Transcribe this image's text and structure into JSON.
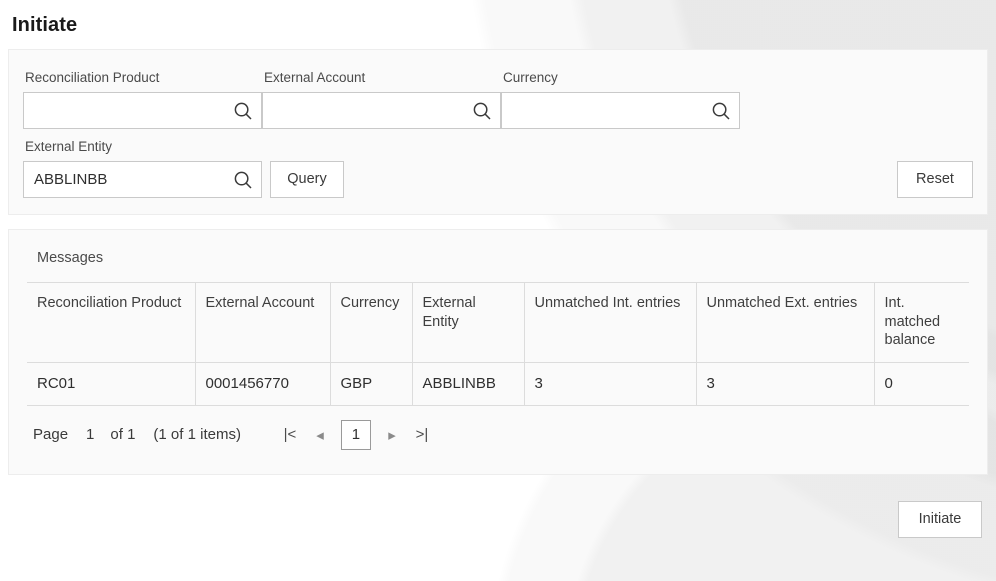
{
  "page": {
    "title": "Initiate"
  },
  "filters": {
    "fields": [
      {
        "label": "Reconciliation Product",
        "value": "",
        "placeholder": "",
        "icon": "search-icon"
      },
      {
        "label": "External Account",
        "value": "",
        "placeholder": "",
        "icon": "search-icon"
      },
      {
        "label": "Currency",
        "value": "",
        "placeholder": "",
        "icon": "search-icon"
      },
      {
        "label": "External Entity",
        "value": "ABBLINBB",
        "placeholder": "",
        "icon": "search-icon"
      }
    ],
    "query_label": "Query",
    "reset_label": "Reset"
  },
  "results": {
    "section_label": "Messages",
    "columns": [
      "Reconciliation Product",
      "External Account",
      "Currency",
      "External Entity",
      "Unmatched Int. entries",
      "Unmatched Ext. entries",
      "Int. matched balance"
    ],
    "rows": [
      {
        "reconciliation_product": "RC01",
        "external_account": "0001456770",
        "currency": "GBP",
        "external_entity": "ABBLINBB",
        "unmatched_int_entries": "3",
        "unmatched_ext_entries": "3",
        "int_matched_balance": "0"
      }
    ],
    "pagination": {
      "page_label": "Page",
      "page_number": "1",
      "of_label": "of 1",
      "items_label": "(1 of 1 items)",
      "first_icon": "|<",
      "prev_icon": "◂",
      "current_page": "1",
      "next_icon": "▸",
      "last_icon": ">|"
    }
  },
  "footer": {
    "initiate_label": "Initiate"
  },
  "colors": {
    "panel_bg": "#fafafa",
    "border": "#dcdcdc",
    "text": "#3f3f3f",
    "title": "#1a1a1a"
  }
}
